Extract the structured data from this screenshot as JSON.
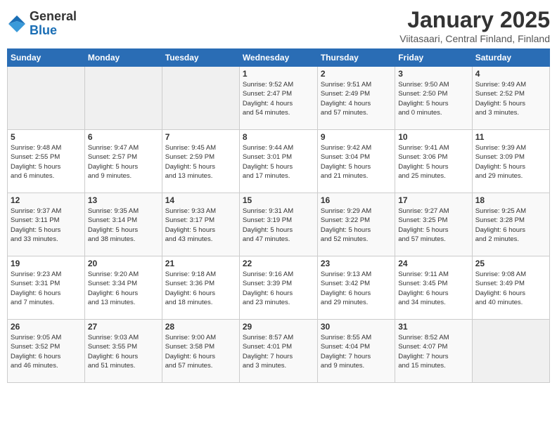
{
  "logo": {
    "general": "General",
    "blue": "Blue"
  },
  "header": {
    "title": "January 2025",
    "subtitle": "Viitasaari, Central Finland, Finland"
  },
  "days_of_week": [
    "Sunday",
    "Monday",
    "Tuesday",
    "Wednesday",
    "Thursday",
    "Friday",
    "Saturday"
  ],
  "weeks": [
    [
      {
        "day": "",
        "info": ""
      },
      {
        "day": "",
        "info": ""
      },
      {
        "day": "",
        "info": ""
      },
      {
        "day": "1",
        "info": "Sunrise: 9:52 AM\nSunset: 2:47 PM\nDaylight: 4 hours\nand 54 minutes."
      },
      {
        "day": "2",
        "info": "Sunrise: 9:51 AM\nSunset: 2:49 PM\nDaylight: 4 hours\nand 57 minutes."
      },
      {
        "day": "3",
        "info": "Sunrise: 9:50 AM\nSunset: 2:50 PM\nDaylight: 5 hours\nand 0 minutes."
      },
      {
        "day": "4",
        "info": "Sunrise: 9:49 AM\nSunset: 2:52 PM\nDaylight: 5 hours\nand 3 minutes."
      }
    ],
    [
      {
        "day": "5",
        "info": "Sunrise: 9:48 AM\nSunset: 2:55 PM\nDaylight: 5 hours\nand 6 minutes."
      },
      {
        "day": "6",
        "info": "Sunrise: 9:47 AM\nSunset: 2:57 PM\nDaylight: 5 hours\nand 9 minutes."
      },
      {
        "day": "7",
        "info": "Sunrise: 9:45 AM\nSunset: 2:59 PM\nDaylight: 5 hours\nand 13 minutes."
      },
      {
        "day": "8",
        "info": "Sunrise: 9:44 AM\nSunset: 3:01 PM\nDaylight: 5 hours\nand 17 minutes."
      },
      {
        "day": "9",
        "info": "Sunrise: 9:42 AM\nSunset: 3:04 PM\nDaylight: 5 hours\nand 21 minutes."
      },
      {
        "day": "10",
        "info": "Sunrise: 9:41 AM\nSunset: 3:06 PM\nDaylight: 5 hours\nand 25 minutes."
      },
      {
        "day": "11",
        "info": "Sunrise: 9:39 AM\nSunset: 3:09 PM\nDaylight: 5 hours\nand 29 minutes."
      }
    ],
    [
      {
        "day": "12",
        "info": "Sunrise: 9:37 AM\nSunset: 3:11 PM\nDaylight: 5 hours\nand 33 minutes."
      },
      {
        "day": "13",
        "info": "Sunrise: 9:35 AM\nSunset: 3:14 PM\nDaylight: 5 hours\nand 38 minutes."
      },
      {
        "day": "14",
        "info": "Sunrise: 9:33 AM\nSunset: 3:17 PM\nDaylight: 5 hours\nand 43 minutes."
      },
      {
        "day": "15",
        "info": "Sunrise: 9:31 AM\nSunset: 3:19 PM\nDaylight: 5 hours\nand 47 minutes."
      },
      {
        "day": "16",
        "info": "Sunrise: 9:29 AM\nSunset: 3:22 PM\nDaylight: 5 hours\nand 52 minutes."
      },
      {
        "day": "17",
        "info": "Sunrise: 9:27 AM\nSunset: 3:25 PM\nDaylight: 5 hours\nand 57 minutes."
      },
      {
        "day": "18",
        "info": "Sunrise: 9:25 AM\nSunset: 3:28 PM\nDaylight: 6 hours\nand 2 minutes."
      }
    ],
    [
      {
        "day": "19",
        "info": "Sunrise: 9:23 AM\nSunset: 3:31 PM\nDaylight: 6 hours\nand 7 minutes."
      },
      {
        "day": "20",
        "info": "Sunrise: 9:20 AM\nSunset: 3:34 PM\nDaylight: 6 hours\nand 13 minutes."
      },
      {
        "day": "21",
        "info": "Sunrise: 9:18 AM\nSunset: 3:36 PM\nDaylight: 6 hours\nand 18 minutes."
      },
      {
        "day": "22",
        "info": "Sunrise: 9:16 AM\nSunset: 3:39 PM\nDaylight: 6 hours\nand 23 minutes."
      },
      {
        "day": "23",
        "info": "Sunrise: 9:13 AM\nSunset: 3:42 PM\nDaylight: 6 hours\nand 29 minutes."
      },
      {
        "day": "24",
        "info": "Sunrise: 9:11 AM\nSunset: 3:45 PM\nDaylight: 6 hours\nand 34 minutes."
      },
      {
        "day": "25",
        "info": "Sunrise: 9:08 AM\nSunset: 3:49 PM\nDaylight: 6 hours\nand 40 minutes."
      }
    ],
    [
      {
        "day": "26",
        "info": "Sunrise: 9:05 AM\nSunset: 3:52 PM\nDaylight: 6 hours\nand 46 minutes."
      },
      {
        "day": "27",
        "info": "Sunrise: 9:03 AM\nSunset: 3:55 PM\nDaylight: 6 hours\nand 51 minutes."
      },
      {
        "day": "28",
        "info": "Sunrise: 9:00 AM\nSunset: 3:58 PM\nDaylight: 6 hours\nand 57 minutes."
      },
      {
        "day": "29",
        "info": "Sunrise: 8:57 AM\nSunset: 4:01 PM\nDaylight: 7 hours\nand 3 minutes."
      },
      {
        "day": "30",
        "info": "Sunrise: 8:55 AM\nSunset: 4:04 PM\nDaylight: 7 hours\nand 9 minutes."
      },
      {
        "day": "31",
        "info": "Sunrise: 8:52 AM\nSunset: 4:07 PM\nDaylight: 7 hours\nand 15 minutes."
      },
      {
        "day": "",
        "info": ""
      }
    ]
  ]
}
